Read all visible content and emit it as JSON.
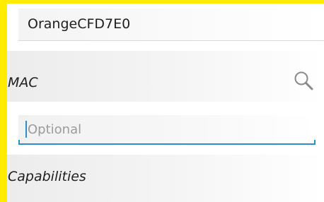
{
  "ssid": {
    "value": "OrangeCFD7E0"
  },
  "mac": {
    "label": "MAC",
    "search_icon": "search-icon"
  },
  "mac_input": {
    "placeholder": "Optional",
    "value": "",
    "accent_color": "#2d8fc7"
  },
  "capabilities": {
    "label": "Capabilities"
  },
  "colors": {
    "border": "#ffec00",
    "text": "#1e1e1e",
    "placeholder": "#9b9b9b"
  }
}
